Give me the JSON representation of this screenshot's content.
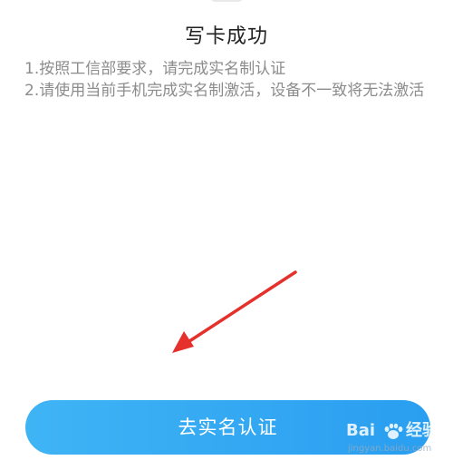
{
  "screen": {
    "title": "写卡成功",
    "notices": [
      "1.按照工信部要求，请完成实名制认证",
      "2.请使用当前手机完成实名制激活，设备不一致将无法激活"
    ],
    "primary_button_label": "去实名认证"
  },
  "watermark": {
    "brand_left": "Bai",
    "brand_right": "经验",
    "domain": "jingyan.baidu.com"
  },
  "colors": {
    "button": "#2fa6f2",
    "arrow": "#e5302b",
    "notice_text": "#8c8c8c",
    "title_text": "#222222"
  },
  "icons": {
    "annotation": "red-arrow-icon",
    "watermark": "baidu-paw-icon"
  }
}
